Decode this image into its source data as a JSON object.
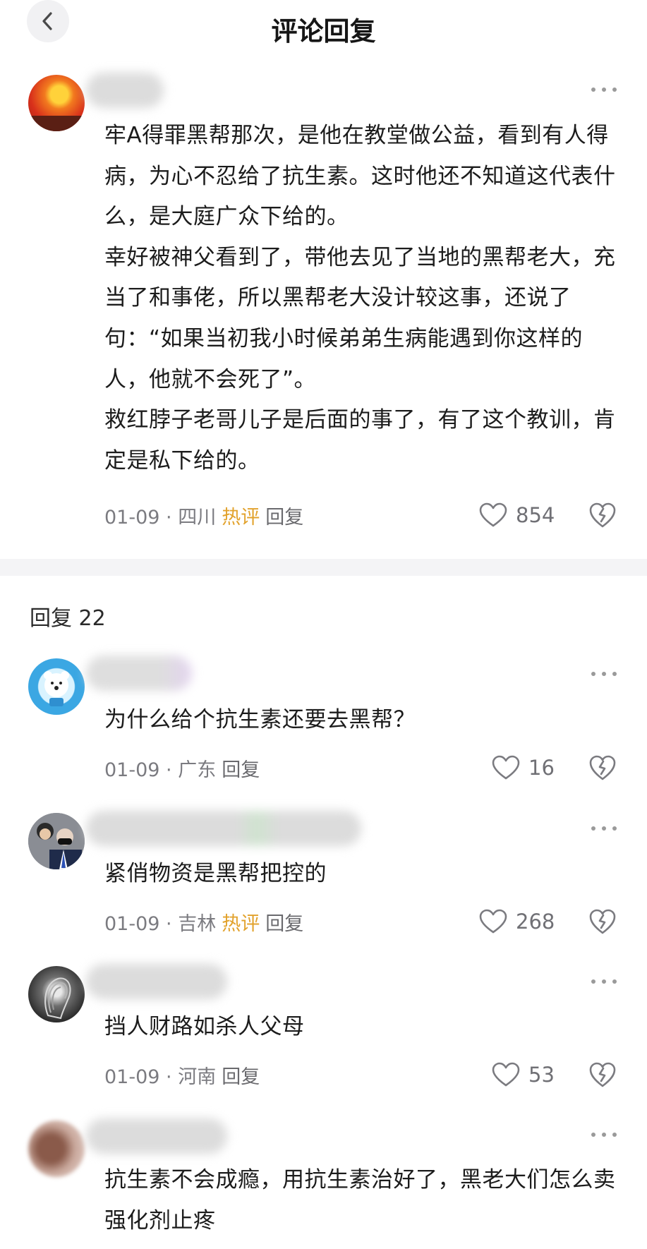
{
  "header": {
    "title": "评论回复",
    "back_icon": "chevron-left-icon"
  },
  "main_comment": {
    "paragraphs": [
      "牢A得罪黑帮那次，是他在教堂做公益，看到有人得病，为心不忍给了抗生素。这时他还不知道这代表什么，是大庭广众下给的。",
      "幸好被神父看到了，带他去见了当地的黑帮老大，充当了和事佬，所以黑帮老大没计较这事，还说了句：“如果当初我小时候弟弟生病能遇到你这样的人，他就不会死了”。",
      "救红脖子老哥儿子是后面的事了，有了这个教训，肯定是私下给的。"
    ],
    "meta": "01-09 · 四川",
    "hot": "热评",
    "reply": "回复",
    "likes": "854"
  },
  "replies_header": "回复 22",
  "replies": [
    {
      "text": "为什么给个抗生素还要去黑帮？",
      "meta": "01-09 · 广东",
      "hot": "",
      "reply": "回复",
      "likes": "16"
    },
    {
      "text": "紧俏物资是黑帮把控的",
      "meta": "01-09 · 吉林",
      "hot": "热评",
      "reply": "回复",
      "likes": "268"
    },
    {
      "text": "挡人财路如杀人父母",
      "meta": "01-09 · 河南",
      "hot": "",
      "reply": "回复",
      "likes": "53"
    },
    {
      "text": "抗生素不会成瘾，用抗生素治好了，黑老大们怎么卖强化剂止疼"
    }
  ],
  "colors": {
    "hot": "#e2a22c",
    "meta": "#7b7b80",
    "divider": "#f4f4f6"
  },
  "icons": [
    "chevron-left-icon",
    "more-dots-icon",
    "heart-icon",
    "broken-heart-icon"
  ]
}
